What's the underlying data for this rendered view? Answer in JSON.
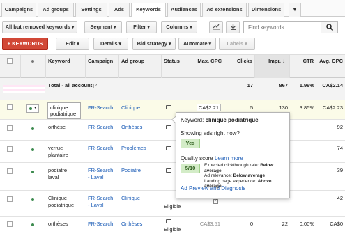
{
  "tabs": [
    "Campaigns",
    "Ad groups",
    "Settings",
    "Ads",
    "Keywords",
    "Audiences",
    "Ad extensions",
    "Dimensions",
    "▾"
  ],
  "filters": {
    "status_filter": "All but removed keywords",
    "segment": "Segment",
    "filter": "Filter",
    "columns": "Columns",
    "search_placeholder": "Find keywords"
  },
  "toolbar": {
    "add_keywords": "+ KEYWORDS",
    "edit": "Edit",
    "details": "Details",
    "bid_strategy": "Bid strategy",
    "automate": "Automate",
    "labels": "Labels"
  },
  "columns": {
    "keyword": "Keyword",
    "campaign": "Campaign",
    "ad_group": "Ad group",
    "status": "Status",
    "max_cpc": "Max. CPC",
    "clicks": "Clicks",
    "impr": "Impr.",
    "ctr": "CTR",
    "avg_cpc": "Avg. CPC"
  },
  "total": {
    "label": "Total - all account",
    "clicks": "17",
    "impr": "867",
    "ctr": "1.96%",
    "avg_cpc": "CA$2.14"
  },
  "rows": [
    {
      "keyword": "clinique podiatrique",
      "campaign": "FR-Search",
      "ad_group": "Clinique",
      "status": "",
      "max_cpc": "CA$2.21",
      "clicks": "5",
      "impr": "130",
      "ctr": "3.85%",
      "avg_cpc": "CA$2.23"
    },
    {
      "keyword": "orthèse",
      "campaign": "FR-Search",
      "ad_group": "Orthèses",
      "status": "",
      "max_cpc": "",
      "clicks": "",
      "impr": "",
      "ctr": "",
      "avg_cpc": "92"
    },
    {
      "keyword": "verrue plantaire",
      "campaign": "FR-Search",
      "ad_group": "Problèmes",
      "status": "",
      "max_cpc": "",
      "clicks": "",
      "impr": "",
      "ctr": "",
      "avg_cpc": "74"
    },
    {
      "keyword": "podiatre laval",
      "campaign": "FR-Search - Laval",
      "ad_group": "Podiatre",
      "status": "",
      "max_cpc": "",
      "clicks": "",
      "impr": "",
      "ctr": "",
      "avg_cpc": "39"
    },
    {
      "keyword": "Clinique podiatrique",
      "campaign": "FR-Search - Laval",
      "ad_group": "Clinique",
      "status": "Eligible",
      "max_cpc": "",
      "clicks": "",
      "impr": "",
      "ctr": "",
      "avg_cpc": "42"
    },
    {
      "keyword": "orthèses",
      "campaign": "FR-Search",
      "ad_group": "Orthèses",
      "status": "Eligible",
      "max_cpc": "CA$3.51",
      "clicks": "0",
      "impr": "22",
      "ctr": "0.00%",
      "avg_cpc": "CA$0"
    }
  ],
  "popup": {
    "keyword_label": "Keyword:",
    "keyword": "clinique podiatrique",
    "showing_question": "Showing ads right now?",
    "showing_answer": "Yes",
    "quality_label": "Quality score",
    "learn_more": "Learn more",
    "score": "5/10",
    "ectr_label": "Expected clickthrough rate:",
    "ectr_value": "Below average",
    "relevance_label": "Ad relevance:",
    "relevance_value": "Below average",
    "landing_label": "Landing page experience:",
    "landing_value": "Above average",
    "preview_link": "Ad Preview and Diagnosis"
  },
  "colors": {
    "accent_red": "#d14836",
    "link_blue": "#1a5bb6",
    "status_green": "#3c8a4e",
    "pill_green": "#d3ecc7"
  }
}
